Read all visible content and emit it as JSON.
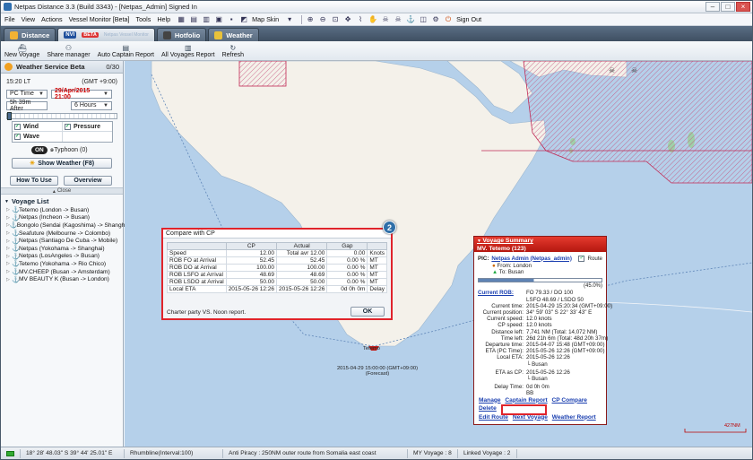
{
  "window": {
    "title": "Netpas Distance 3.3 (Build 3343) - [Netpas_Admin] Signed In"
  },
  "menu": {
    "items": [
      "File",
      "View",
      "Actions",
      "Vessel Monitor [Beta]",
      "Tools",
      "Help"
    ],
    "map_skin": "Map Skin",
    "sign_out": "Sign Out"
  },
  "tabs": [
    {
      "label": "Distance"
    },
    {
      "label": "NVI",
      "badge": "BETA",
      "sub": "Netpas Vessel Monitor"
    },
    {
      "label": "Hotfolio"
    },
    {
      "label": "Weather"
    }
  ],
  "toolbar": [
    "New Voyage",
    "Share manager",
    "Auto Captain Report",
    "All Voyages Report",
    "Refresh"
  ],
  "weather_panel": {
    "title": "Weather Service Beta",
    "count": "0/30",
    "local_time": "15:20 LT",
    "gmt": "(GMT +9:00)",
    "time_mode": "PC Time",
    "date": "29/Apr/2015 21:00",
    "after": "5h 39m After",
    "interval": "6 Hours",
    "layers": [
      "Wind",
      "Pressure",
      "Wave"
    ],
    "toggle_on": "ON",
    "typhoon": "Typhoon (0)",
    "show_weather": "Show Weather (F8)",
    "how_to_use": "How To Use",
    "overview": "Overview",
    "close": "Close"
  },
  "voyage_list": {
    "title": "Voyage List",
    "items": [
      "Tetemo (London -> Busan)",
      "Netpas (Incheon -> Busan)",
      "Bongolo (Sendai (Kagoshima) -> Shanghai",
      "Seafuture (Melbourne -> Colombo)",
      "Netpas (Santiago De Cuba -> Mobile)",
      "Netpas (Yokohama -> Shanghai)",
      "Netpas (LosAngeles -> Busan)",
      "Tetemo (Yokohama -> Rio Chico)",
      "MV.CHEEP (Busan -> Amsterdam)",
      "MV BEAUTY K (Busan -> London)"
    ]
  },
  "cp_dialog": {
    "title": "Compare with CP",
    "headers": [
      "",
      "CP",
      "Actual",
      "Gap",
      ""
    ],
    "rows": [
      [
        "Speed",
        "12.00",
        "Total avr 12.00",
        "0.00",
        "Knots"
      ],
      [
        "ROB FO at Arrival",
        "52.45",
        "52.45",
        "0.00 %",
        "MT"
      ],
      [
        "ROB DO at Arrival",
        "100.00",
        "100.00",
        "0.00 %",
        "MT"
      ],
      [
        "ROB LSFO at Arrival",
        "48.69",
        "48.69",
        "0.00 %",
        "MT"
      ],
      [
        "ROB LSDO at Arrival",
        "50.00",
        "50.00",
        "0.00 %",
        "MT"
      ],
      [
        "Local ETA",
        "2015-05-26 12:26",
        "2015-05-26 12:26",
        "0d 0h 0m",
        "Delay"
      ]
    ],
    "footer": "Charter party VS. Noon report.",
    "ok": "OK"
  },
  "steps": [
    "1",
    "2"
  ],
  "voyage_summary": {
    "title": "Voyage Summary",
    "vessel": "MV. Tetemo (123)",
    "pic_label": "PIC:",
    "pic": "Netpas Admin (Netpas_admin)",
    "route": "Route",
    "from_label": "From:",
    "from": "London",
    "to_label": "To:",
    "to": "Busan",
    "progress": 0.45,
    "progress_text": "(45.0%)",
    "rob_label": "Current ROB:",
    "rob_line1": "FO 79.33 / DO 100",
    "rob_line2": "LSFO 48.69 / LSDO 50",
    "fields": [
      [
        "Current time:",
        "2015-04-29 15:20:34 (GMT+09:00)"
      ],
      [
        "Current position:",
        "34° 59' 03\" S  22° 33' 43\" E"
      ],
      [
        "Current speed:",
        "12.0 knots"
      ],
      [
        "CP speed:",
        "12.0 knots"
      ],
      [
        "Distance left:",
        "7,741 NM (Total: 14,072 NM)"
      ],
      [
        "Time left:",
        "26d 21h 6m (Total: 48d 20h 37m)"
      ],
      [
        "Departure time:",
        "2015-04-07 15:48 (GMT+09:00)"
      ],
      [
        "ETA (PC Time):",
        "2015-05-26 12:26 (GMT+09:00)"
      ],
      [
        "Local ETA:",
        "2015-05-26 12:26"
      ]
    ],
    "local_eta_sub": "└ Busan",
    "eta_cp_label": "ETA as CP:",
    "eta_cp": "2015-05-26 12:26",
    "eta_cp_sub": "└ Busan",
    "delay_label": "Delay Time:",
    "delay": "0d 0h 0m",
    "last_label": "",
    "last_value": "BB",
    "links": [
      "Manage",
      "Captain Report",
      "CP Compare",
      "Delete",
      "Edit Route",
      "Next Voyage",
      "Weather Report"
    ]
  },
  "map": {
    "vessel_label": "Tetemo",
    "vessel_time": "2015-04-29 15:00:00 (GMT+09:00)",
    "vessel_forecast": "(Forecast)",
    "scale": "427NM"
  },
  "status": {
    "coords": "18° 28' 48.03\" S   39° 44' 25.01\" E",
    "rhumbline": "Rhumbline(Interval:100)",
    "piracy": "Anti Piracy : 250NM outer route from Somalia east coast",
    "my_voyage": "MY Voyage : 8",
    "linked_voyage": "Linked Voyage : 2"
  }
}
